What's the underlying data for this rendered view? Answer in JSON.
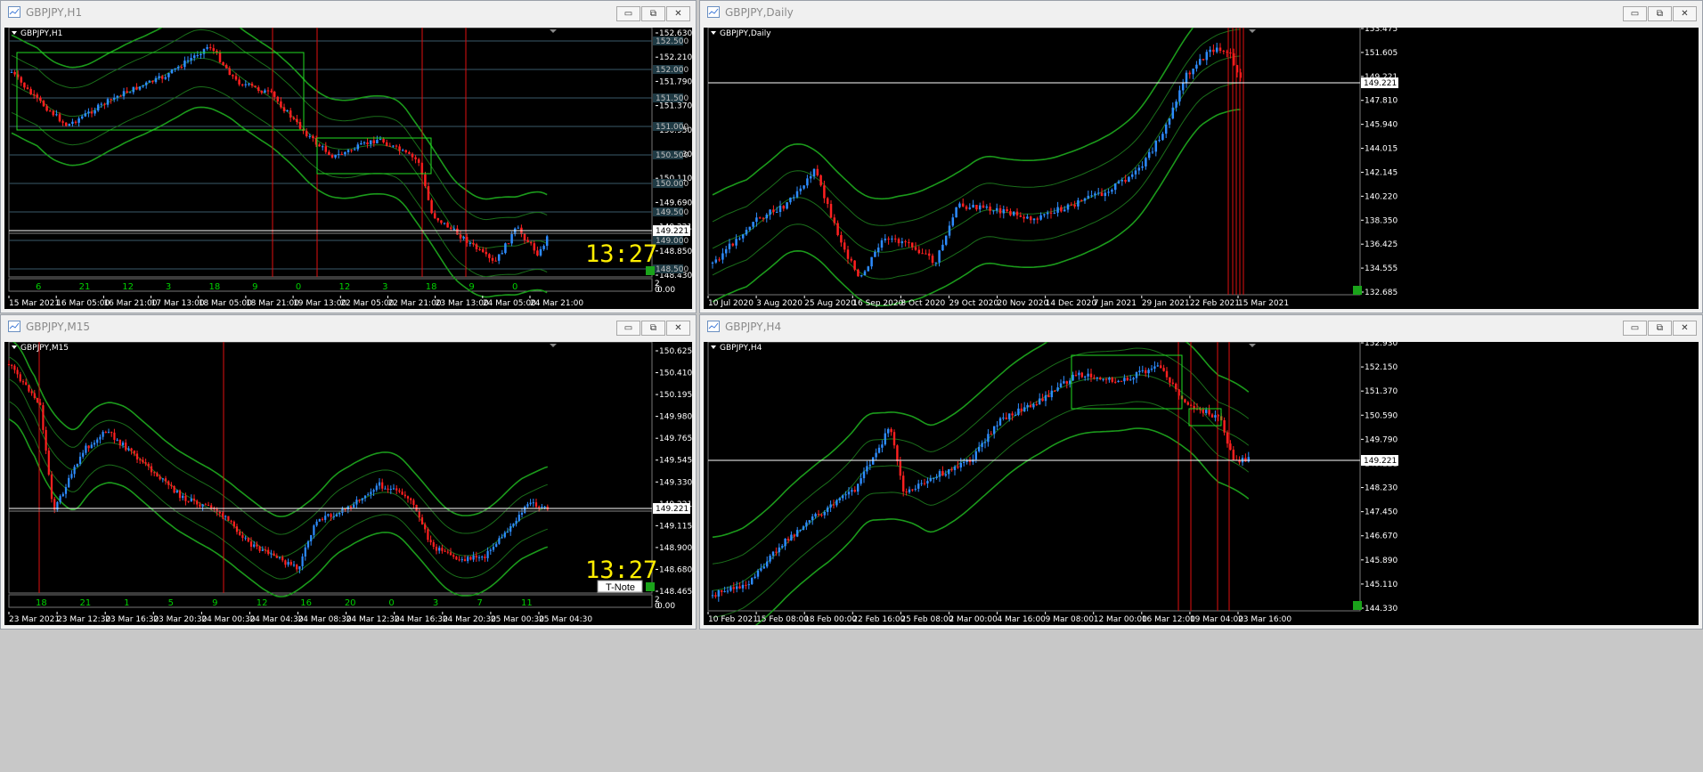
{
  "colors": {
    "up": "#2d8cff",
    "down": "#ff2020",
    "band": "#1b9a1b",
    "bandInner": "#1a6e1a",
    "vline": "#e01010",
    "box": "#22dd22",
    "hline": "#ffffff"
  },
  "windows": {
    "h1": {
      "title": "GBPJPY,H1",
      "symbol": "GBPJPY,H1",
      "prices": [
        "152.630",
        "152.210",
        "151.790",
        "151.370",
        "150.950",
        "150.530",
        "150.110",
        "149.690",
        "149.221",
        "148.850",
        "148.430"
      ],
      "levels": [
        "152.500",
        "152.000",
        "151.500",
        "151.000",
        "150.500",
        "150.000",
        "149.500",
        "149.000",
        "148.500"
      ],
      "current": "149.221",
      "times": [
        "15 Mar 2021",
        "16 Mar 05:00",
        "16 Mar 21:00",
        "17 Mar 13:00",
        "18 Mar 05:00",
        "18 Mar 21:00",
        "19 Mar 13:00",
        "22 Mar 05:00",
        "22 Mar 21:00",
        "23 Mar 13:00",
        "24 Mar 05:00",
        "24 Mar 21:00"
      ],
      "osc": [
        "6",
        "21",
        "12",
        "3",
        "18",
        "9",
        "0",
        "12",
        "3",
        "18",
        "9",
        "0"
      ],
      "osc_scale": [
        "2",
        "0",
        "0.00"
      ],
      "clock": "13:27"
    },
    "daily": {
      "title": "GBPJPY,Daily",
      "symbol": "GBPJPY,Daily",
      "prices": [
        "153.475",
        "151.605",
        "149.221",
        "147.810",
        "145.940",
        "144.015",
        "142.145",
        "140.220",
        "138.350",
        "136.425",
        "134.555",
        "132.685"
      ],
      "current": "149.221",
      "times": [
        "10 Jul 2020",
        "3 Aug 2020",
        "25 Aug 2020",
        "16 Sep 2020",
        "8 Oct 2020",
        "29 Oct 2020",
        "20 Nov 2020",
        "14 Dec 2020",
        "7 Jan 2021",
        "29 Jan 2021",
        "22 Feb 2021",
        "15 Mar 2021"
      ]
    },
    "m15": {
      "title": "GBPJPY,M15",
      "symbol": "GBPJPY,M15",
      "prices": [
        "150.625",
        "150.410",
        "150.195",
        "149.980",
        "149.765",
        "149.545",
        "149.330",
        "149.221",
        "149.115",
        "148.900",
        "148.680",
        "148.465"
      ],
      "current": "149.221",
      "times": [
        "23 Mar 2021",
        "23 Mar 12:30",
        "23 Mar 16:30",
        "23 Mar 20:30",
        "24 Mar 00:30",
        "24 Mar 04:30",
        "24 Mar 08:30",
        "24 Mar 12:30",
        "24 Mar 16:30",
        "24 Mar 20:30",
        "25 Mar 00:30",
        "25 Mar 04:30"
      ],
      "osc": [
        "18",
        "21",
        "1",
        "5",
        "9",
        "12",
        "16",
        "20",
        "0",
        "3",
        "7",
        "11"
      ],
      "osc_scale": [
        "2",
        "0",
        "0.00"
      ],
      "clock": "13:27",
      "tnote": "T-Note"
    },
    "h4": {
      "title": "GBPJPY,H4",
      "symbol": "GBPJPY,H4",
      "prices": [
        "152.930",
        "152.150",
        "151.370",
        "150.590",
        "149.790",
        "149.221",
        "148.230",
        "147.450",
        "146.670",
        "145.890",
        "145.110",
        "144.330"
      ],
      "current": "149.221",
      "times": [
        "10 Feb 2021",
        "15 Feb 08:00",
        "18 Feb 00:00",
        "22 Feb 16:00",
        "25 Feb 08:00",
        "2 Mar 00:00",
        "4 Mar 16:00",
        "9 Mar 08:00",
        "12 Mar 00:00",
        "16 Mar 12:00",
        "19 Mar 04:00",
        "23 Mar 16:00"
      ]
    }
  },
  "buttons": {
    "minimize": "▭",
    "restore": "⧉",
    "close": "✕"
  }
}
